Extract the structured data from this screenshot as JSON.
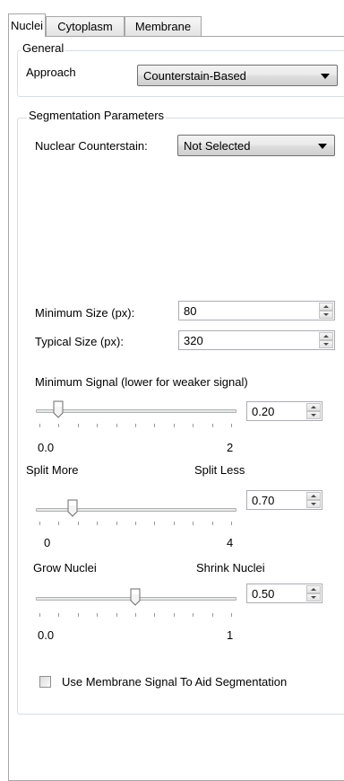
{
  "tabs": [
    {
      "label": "Nuclei",
      "active": true
    },
    {
      "label": "Cytoplasm",
      "active": false
    },
    {
      "label": "Membrane",
      "active": false
    }
  ],
  "general": {
    "legend": "General",
    "approach_label": "Approach",
    "approach_value": "Counterstain-Based"
  },
  "segmentation": {
    "legend": "Segmentation Parameters",
    "counterstain_label": "Nuclear Counterstain:",
    "counterstain_value": "Not Selected",
    "min_size_label": "Minimum Size (px):",
    "min_size_value": "80",
    "typical_size_label": "Typical Size (px):",
    "typical_size_value": "320",
    "min_signal": {
      "label": "Minimum Signal (lower for weaker signal)",
      "value": "0.20",
      "min_label": "0.0",
      "max_label": "2",
      "min": 0,
      "max": 2,
      "current": 0.2
    },
    "split": {
      "left_label": "Split More",
      "right_label": "Split Less",
      "value": "0.70",
      "min_label": "0",
      "max_label": "4",
      "min": 0,
      "max": 4,
      "current": 0.7
    },
    "grow": {
      "left_label": "Grow Nuclei",
      "right_label": "Shrink Nuclei",
      "value": "0.50",
      "min_label": "0.0",
      "max_label": "1",
      "min": 0,
      "max": 1,
      "current": 0.5
    },
    "membrane_checkbox_label": "Use Membrane Signal To Aid Segmentation",
    "membrane_checkbox_checked": false
  },
  "colors": {
    "tab_border": "#a6a6a6",
    "group_border": "#d5dfe5",
    "input_border": "#abadb3"
  }
}
